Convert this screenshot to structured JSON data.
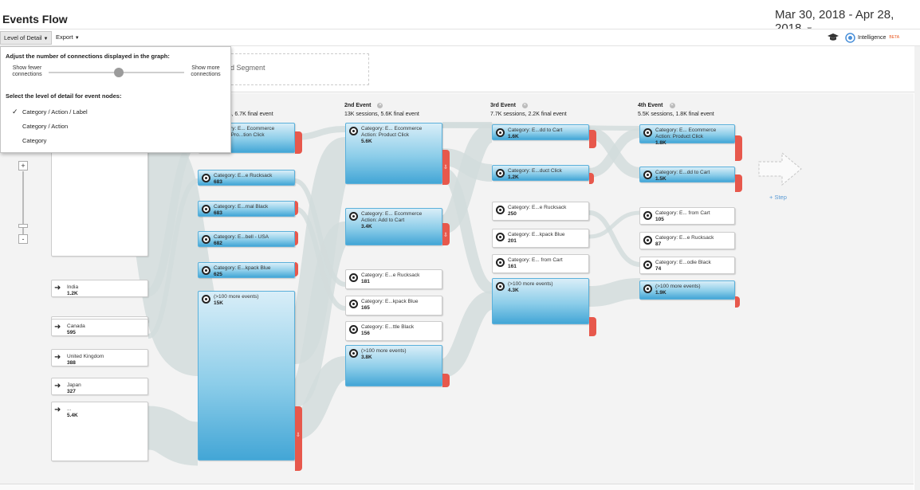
{
  "page": {
    "title": "Events Flow",
    "date_range": "Mar 30, 2018 - Apr 28, 2018"
  },
  "toolbar": {
    "level_of_detail": "Level of Detail",
    "export": "Export",
    "intelligence": "Intelligence",
    "beta": "BETA"
  },
  "segment": {
    "add_segment": "ld Segment"
  },
  "popup": {
    "connections_heading": "Adjust the number of connections displayed in the graph:",
    "show_fewer": "Show fewer connections",
    "show_more": "Show more connections",
    "slider_level": 0.52,
    "detail_heading": "Select the level of detail for event nodes:",
    "options": [
      {
        "label": "Category / Action / Label",
        "selected": true
      },
      {
        "label": "Category / Action",
        "selected": false
      },
      {
        "label": "Category",
        "selected": false
      }
    ]
  },
  "columns": [
    {
      "name": "",
      "stats": "s, 6.7K final event"
    },
    {
      "name": "2nd Event",
      "stats": "13K sessions, 5.6K final event"
    },
    {
      "name": "3rd Event",
      "stats": "7.7K sessions, 2.2K final event"
    },
    {
      "name": "4th Event",
      "stats": "5.5K sessions, 1.8K final event"
    }
  ],
  "countries": [
    {
      "name": "India",
      "value": "1.2K"
    },
    {
      "name": "Canada",
      "value": "595"
    },
    {
      "name": "United Kingdom",
      "value": "388"
    },
    {
      "name": "Japan",
      "value": "327"
    },
    {
      "name": "...",
      "value": "5.4K"
    }
  ],
  "col1": [
    {
      "label": "Category: E... Ecommerce",
      "label2": "Action: Pro...tion Click",
      "value": ""
    },
    {
      "label": "Category: E...e Rucksack",
      "value": "683"
    },
    {
      "label": "Category: E...rnal Black",
      "value": "683"
    },
    {
      "label": "Category: E...bell - USA",
      "value": "682"
    },
    {
      "label": "Category: E...kpack Blue",
      "value": "625"
    },
    {
      "label": "(>100 more events)",
      "value": "15K"
    }
  ],
  "col2": [
    {
      "label": "Category: E... Ecommerce",
      "label2": "Action: Product Click",
      "value": "5.6K"
    },
    {
      "label": "Category: E... Ecommerce",
      "label2": "Action: Add to Cart",
      "value": "3.4K"
    },
    {
      "label": "Category: E...e Rucksack",
      "value": "181"
    },
    {
      "label": "Category: E...kpack Blue",
      "value": "165"
    },
    {
      "label": "Category: E...ttle Black",
      "value": "156"
    },
    {
      "label": "(>100 more events)",
      "value": "3.8K"
    }
  ],
  "col3": [
    {
      "label": "Category: E...dd to Cart",
      "value": "1.6K"
    },
    {
      "label": "Category: E...duct Click",
      "value": "1.2K"
    },
    {
      "label": "Category: E...e Rucksack",
      "value": "250"
    },
    {
      "label": "Category: E...kpack Blue",
      "value": "201"
    },
    {
      "label": "Category: E... from Cart",
      "value": "161"
    },
    {
      "label": "(>100 more events)",
      "value": "4.3K"
    }
  ],
  "col4": [
    {
      "label": "Category: E... Ecommerce",
      "label2": "Action: Product Click",
      "value": "1.8K"
    },
    {
      "label": "Category: E...dd to Cart",
      "value": "1.5K"
    },
    {
      "label": "Category: E... from Cart",
      "value": "105"
    },
    {
      "label": "Category: E...e Rucksack",
      "value": "87"
    },
    {
      "label": "Category: E...odie Black",
      "value": "74"
    },
    {
      "label": "(>100 more events)",
      "value": "1.9K"
    }
  ],
  "add_step": "+ Step",
  "colors": {
    "node_blue": "#43a6d6",
    "dropoff_red": "#e7584c",
    "flow_gray": "#d5dddd",
    "link_blue": "#5b9bd5"
  }
}
